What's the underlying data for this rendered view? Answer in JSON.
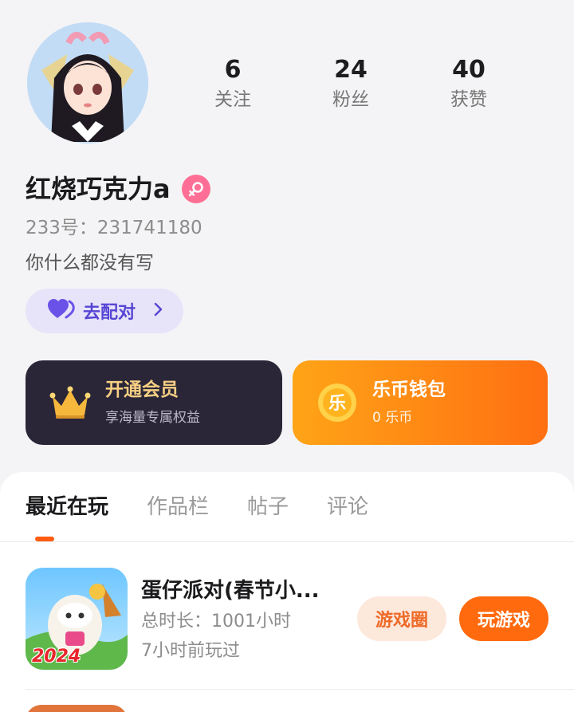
{
  "profile": {
    "nickname": "红烧巧克力a",
    "id_text": "233号：231741180",
    "bio": "你什么都没有写",
    "gender": "female"
  },
  "stats": [
    {
      "value": "6",
      "label": "关注"
    },
    {
      "value": "24",
      "label": "粉丝"
    },
    {
      "value": "40",
      "label": "获赞"
    }
  ],
  "match": {
    "label": "去配对"
  },
  "cards": {
    "vip": {
      "title": "开通会员",
      "subtitle": "享海量专属权益"
    },
    "wallet": {
      "title": "乐币钱包",
      "subtitle": "0 乐币",
      "coin_char": "乐"
    }
  },
  "tabs": [
    "最近在玩",
    "作品栏",
    "帖子",
    "评论"
  ],
  "active_tab": 0,
  "games": [
    {
      "title": "蛋仔派对(春节小...",
      "duration": "总时长：1001小时",
      "last_played": "7小时前玩过",
      "icon_badge": "2024",
      "circle_button": "游戏圈",
      "play_button": "玩游戏"
    }
  ],
  "colors": {
    "accent": "#ff6a0e",
    "match_text": "#5746d4",
    "vip_card": "#2a2638",
    "vip_gold": "#f6cf83",
    "gender_badge": "#ff6f95"
  }
}
